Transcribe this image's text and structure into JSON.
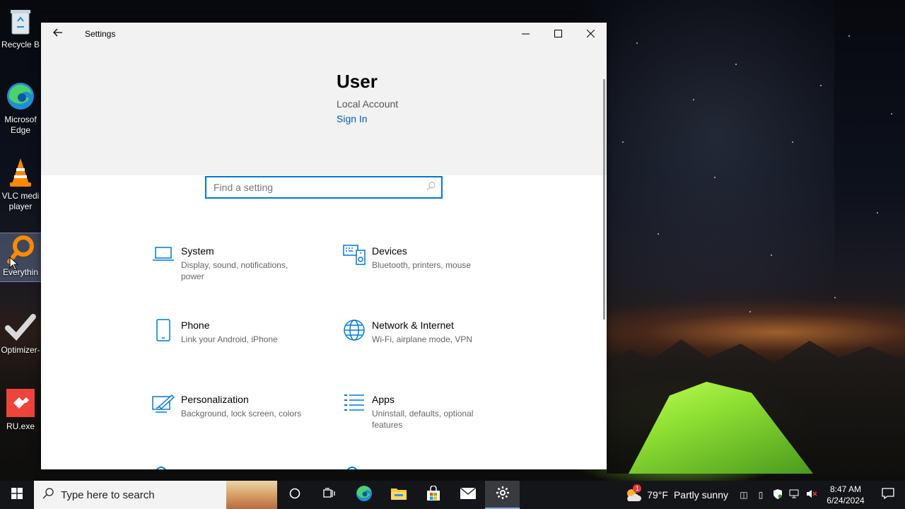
{
  "desktop": {
    "icons": [
      {
        "label": "Recycle B",
        "icon": "recycle-bin-icon"
      },
      {
        "label": "Microsof Edge",
        "icon": "edge-icon"
      },
      {
        "label": "VLC medi player",
        "icon": "vlc-icon"
      },
      {
        "label": "Everythin",
        "icon": "everything-search-icon"
      },
      {
        "label": "Optimizer-",
        "icon": "checkmark-icon"
      },
      {
        "label": "RU.exe",
        "icon": "anydesk-icon"
      }
    ]
  },
  "window": {
    "title": "Settings",
    "controls": {
      "minimize": "—",
      "maximize": "☐",
      "close": "✕"
    }
  },
  "account": {
    "name": "User",
    "type": "Local Account",
    "sign_in": "Sign In"
  },
  "search": {
    "placeholder": "Find a setting"
  },
  "categories": [
    {
      "title": "System",
      "desc": "Display, sound, notifications, power",
      "icon": "laptop-icon"
    },
    {
      "title": "Devices",
      "desc": "Bluetooth, printers, mouse",
      "icon": "keyboard-speaker-icon"
    },
    {
      "title": "Phone",
      "desc": "Link your Android, iPhone",
      "icon": "phone-icon"
    },
    {
      "title": "Network & Internet",
      "desc": "Wi-Fi, airplane mode, VPN",
      "icon": "globe-icon"
    },
    {
      "title": "Personalization",
      "desc": "Background, lock screen, colors",
      "icon": "paint-screen-icon"
    },
    {
      "title": "Apps",
      "desc": "Uninstall, defaults, optional features",
      "icon": "apps-list-icon"
    }
  ],
  "taskbar": {
    "search_placeholder": "Type here to search",
    "pinned": [
      "cortana-icon",
      "task-view-icon",
      "edge-icon",
      "file-explorer-icon",
      "store-icon",
      "mail-icon",
      "settings-icon"
    ],
    "weather": {
      "temp": "79°F",
      "condition": "Partly sunny",
      "badge": "1"
    },
    "clock": {
      "time": "8:47 AM",
      "date": "6/24/2024"
    }
  },
  "colors": {
    "accent": "#0078d7",
    "link": "#0063b1"
  }
}
